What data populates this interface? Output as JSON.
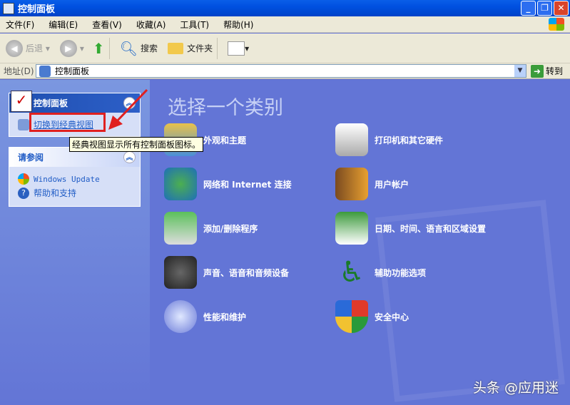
{
  "window": {
    "title": "控制面板"
  },
  "menu": [
    "文件(F)",
    "编辑(E)",
    "查看(V)",
    "收藏(A)",
    "工具(T)",
    "帮助(H)"
  ],
  "toolbar": {
    "back": "后退",
    "search": "搜索",
    "folders": "文件夹"
  },
  "address": {
    "label": "地址(D)",
    "value": "控制面板",
    "go": "转到"
  },
  "left": {
    "panel_title": "控制面板",
    "switch_link": "切换到经典视图",
    "tooltip": "经典视图显示所有控制面板图标。",
    "see_also_title": "请参阅",
    "see_also": [
      "Windows Update",
      "帮助和支持"
    ]
  },
  "main": {
    "heading": "选择一个类别",
    "categories": [
      "外观和主题",
      "打印机和其它硬件",
      "网络和 Internet 连接",
      "用户帐户",
      "添加/删除程序",
      "日期、时间、语言和区域设置",
      "声音、语音和音频设备",
      "辅助功能选项",
      "性能和维护",
      "安全中心"
    ]
  },
  "watermark": "头条 @应用迷"
}
